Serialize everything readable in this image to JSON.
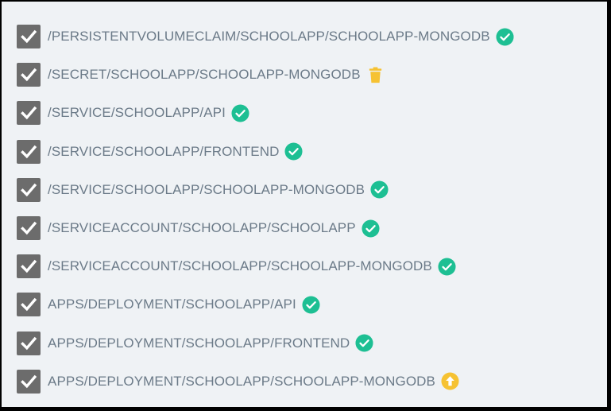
{
  "colors": {
    "synced": "#1dbf93",
    "pending": "#f6c232",
    "checkbox": "#6c6c6c",
    "label": "#6b7a88",
    "background": "#eff2f5"
  },
  "resources": [
    {
      "label": "/PERSISTENTVOLUMECLAIM/SCHOOLAPP/SCHOOLAPP-MONGODB",
      "checked": true,
      "status_icon": "check-circle-icon"
    },
    {
      "label": "/SECRET/SCHOOLAPP/SCHOOLAPP-MONGODB",
      "checked": true,
      "status_icon": "trash-icon"
    },
    {
      "label": "/SERVICE/SCHOOLAPP/API",
      "checked": true,
      "status_icon": "check-circle-icon"
    },
    {
      "label": "/SERVICE/SCHOOLAPP/FRONTEND",
      "checked": true,
      "status_icon": "check-circle-icon"
    },
    {
      "label": "/SERVICE/SCHOOLAPP/SCHOOLAPP-MONGODB",
      "checked": true,
      "status_icon": "check-circle-icon"
    },
    {
      "label": "/SERVICEACCOUNT/SCHOOLAPP/SCHOOLAPP",
      "checked": true,
      "status_icon": "check-circle-icon"
    },
    {
      "label": "/SERVICEACCOUNT/SCHOOLAPP/SCHOOLAPP-MONGODB",
      "checked": true,
      "status_icon": "check-circle-icon"
    },
    {
      "label": "APPS/DEPLOYMENT/SCHOOLAPP/API",
      "checked": true,
      "status_icon": "check-circle-icon"
    },
    {
      "label": "APPS/DEPLOYMENT/SCHOOLAPP/FRONTEND",
      "checked": true,
      "status_icon": "check-circle-icon"
    },
    {
      "label": "APPS/DEPLOYMENT/SCHOOLAPP/SCHOOLAPP-MONGODB",
      "checked": true,
      "status_icon": "arrow-up-circle-icon"
    }
  ]
}
